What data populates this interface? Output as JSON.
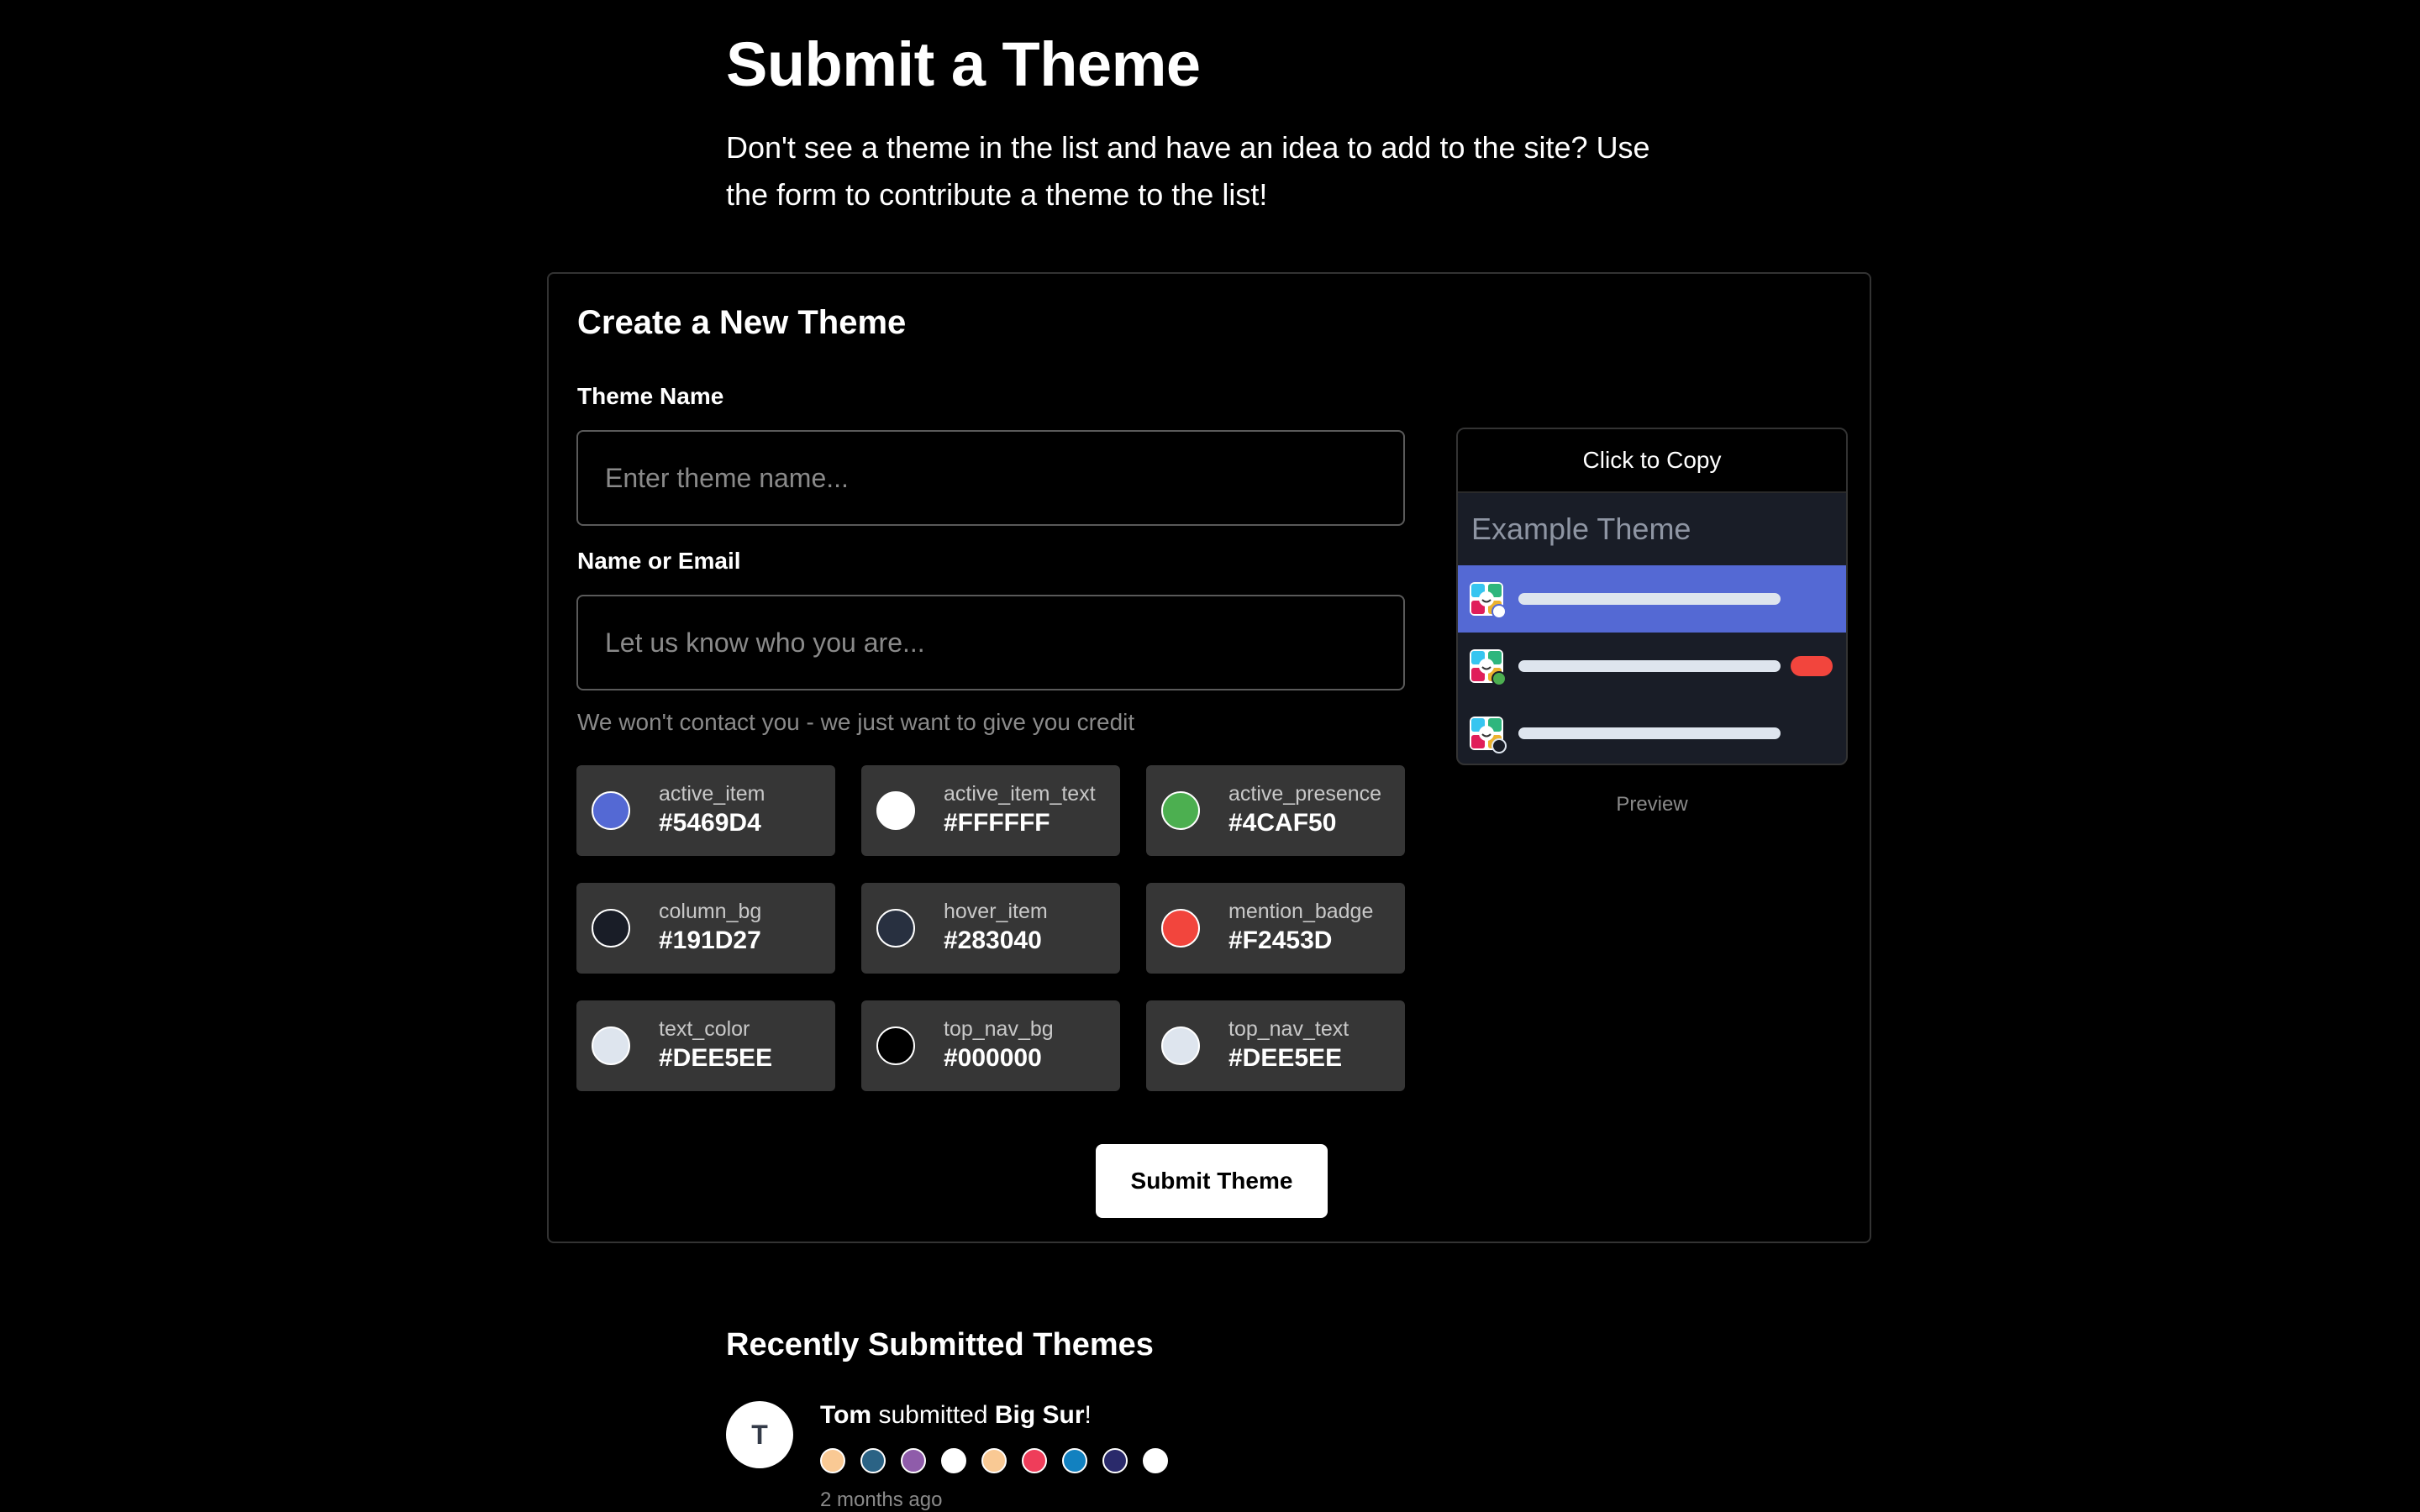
{
  "header": {
    "title": "Submit a Theme",
    "subtitle": "Don't see a theme in the list and have an idea to add to the site? Use the form to contribute a theme to the list!"
  },
  "form": {
    "title": "Create a New Theme",
    "theme_name_label": "Theme Name",
    "theme_name_placeholder": "Enter theme name...",
    "theme_name_value": "",
    "author_label": "Name or Email",
    "author_placeholder": "Let us know who you are...",
    "author_value": "",
    "author_hint": "We won't contact you - we just want to give you credit",
    "submit_label": "Submit Theme",
    "colors": [
      {
        "name": "active_item",
        "hex": "#5469D4"
      },
      {
        "name": "active_item_text",
        "hex": "#FFFFFF"
      },
      {
        "name": "active_presence",
        "hex": "#4CAF50"
      },
      {
        "name": "column_bg",
        "hex": "#191D27"
      },
      {
        "name": "hover_item",
        "hex": "#283040"
      },
      {
        "name": "mention_badge",
        "hex": "#F2453D"
      },
      {
        "name": "text_color",
        "hex": "#DEE5EE"
      },
      {
        "name": "top_nav_bg",
        "hex": "#000000"
      },
      {
        "name": "top_nav_text",
        "hex": "#DEE5EE"
      }
    ]
  },
  "preview": {
    "header_label": "Click to Copy",
    "theme_name": "Example Theme",
    "caption": "Preview",
    "avatar_icon": "slack-avatar-icon"
  },
  "recent": {
    "title": "Recently Submitted Themes",
    "items": [
      {
        "avatar_letter": "T",
        "user": "Tom",
        "verb": "submitted",
        "theme": "Big Sur",
        "suffix": "!",
        "time": "2 months ago",
        "colors": [
          "#F9C994",
          "#2B6385",
          "#8F5CAA",
          "#FFFFFF",
          "#F9C994",
          "#EF3D5A",
          "#1281C0",
          "#2A2A6B",
          "#FFFFFF"
        ]
      }
    ]
  }
}
